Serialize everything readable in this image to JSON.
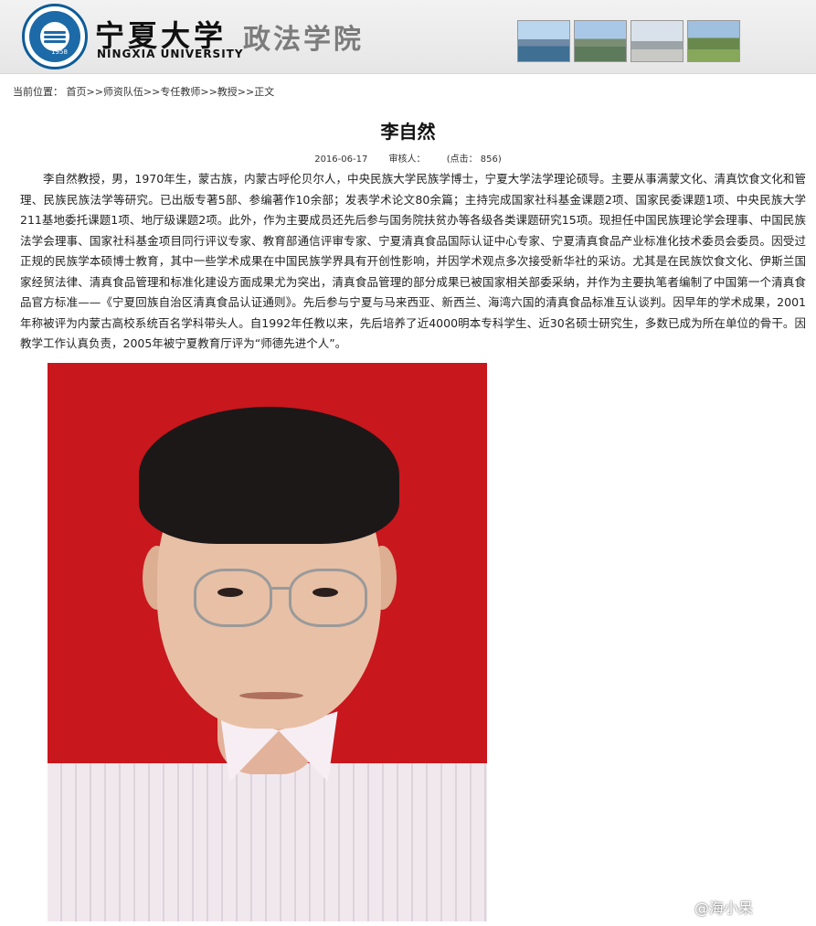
{
  "header": {
    "uni_cn": "宁夏大学",
    "uni_en": "NINGXIA UNIVERSITY",
    "college": "政法学院",
    "logo_year": "1958"
  },
  "breadcrumb": "当前位置： 首页>>师资队伍>>专任教师>>教授>>正文",
  "article": {
    "title": "李自然",
    "date": "2016-06-17",
    "reviewer": "审核人：",
    "clicks": "(点击： 856)",
    "body": "李自然教授，男，1970年生，蒙古族，内蒙古呼伦贝尔人，中央民族大学民族学博士，宁夏大学法学理论硕导。主要从事满蒙文化、清真饮食文化和管理、民族民族法学等研究。已出版专著5部、参编著作10余部；发表学术论文80余篇；主持完成国家社科基金课题2项、国家民委课题1项、中央民族大学211基地委托课题1项、地厅级课题2项。此外，作为主要成员还先后参与国务院扶贫办等各级各类课题研究15项。现担任中国民族理论学会理事、中国民族法学会理事、国家社科基金项目同行评议专家、教育部通信评审专家、宁夏清真食品国际认证中心专家、宁夏清真食品产业标准化技术委员会委员。因受过正规的民族学本硕博士教育，其中一些学术成果在中国民族学界具有开创性影响，并因学术观点多次接受新华社的采访。尤其是在民族饮食文化、伊斯兰国家经贸法律、清真食品管理和标准化建设方面成果尤为突出，清真食品管理的部分成果已被国家相关部委采纳，并作为主要执笔者编制了中国第一个清真食品官方标准——《宁夏回族自治区清真食品认证通则》。先后参与宁夏与马来西亚、新西兰、海湾六国的清真食品标准互认谈判。因早年的学术成果，2001年称被评为内蒙古高校系统百名学科带头人。自1992年任教以来，先后培养了近4000明本专科学生、近30名硕士研究生，多数已成为所在单位的骨干。因教学工作认真负责，2005年被宁夏教育厅评为“师德先进个人”。"
  },
  "watermark": "@海小呆",
  "colors": {
    "portrait_bg": "#c8171d",
    "accent": "#0e5c99"
  }
}
